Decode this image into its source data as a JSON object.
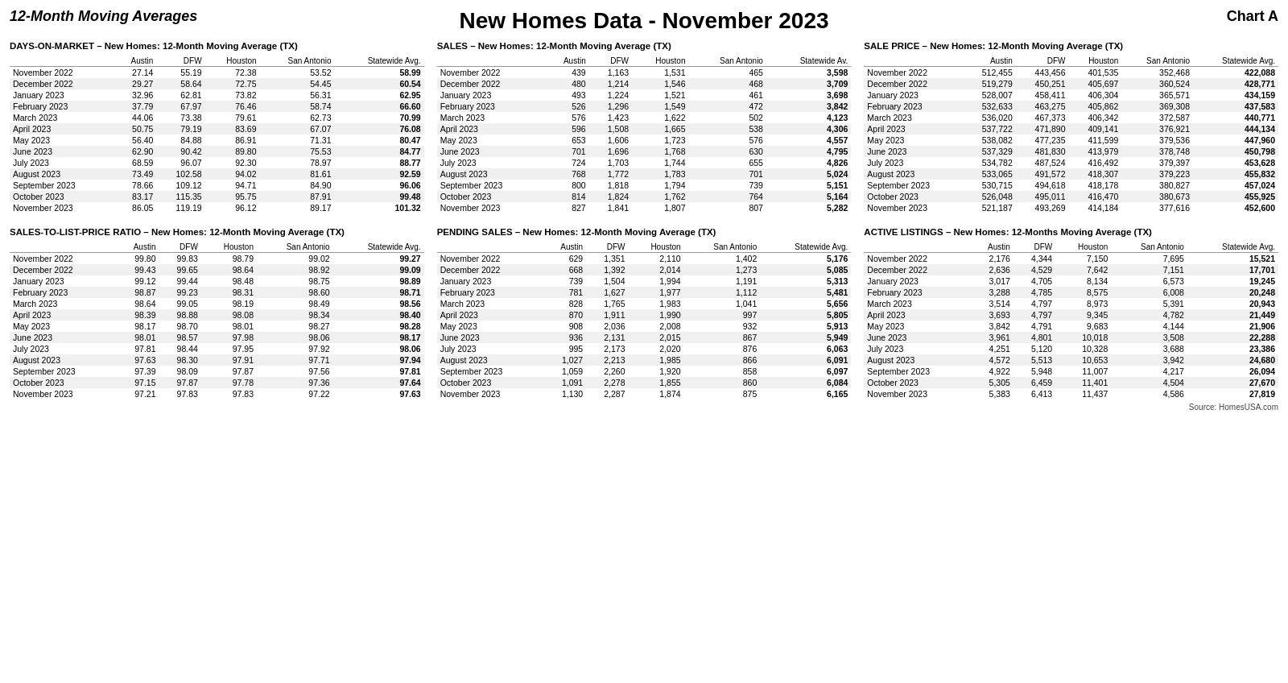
{
  "header": {
    "left": "12-Month Moving Averages",
    "center": "New Homes Data - November 2023",
    "right": "Chart A"
  },
  "sections": {
    "days_on_market": {
      "title": "DAYS-ON-MARKET – New Homes:  12-Month Moving Average (TX)",
      "columns": [
        "",
        "Austin",
        "DFW",
        "Houston",
        "San Antonio",
        "Statewide Avg."
      ],
      "rows": [
        [
          "November 2022",
          "27.14",
          "55.19",
          "72.38",
          "53.52",
          "58.99"
        ],
        [
          "December 2022",
          "29.27",
          "58.64",
          "72.75",
          "54.45",
          "60.54"
        ],
        [
          "January 2023",
          "32.96",
          "62.81",
          "73.82",
          "56.31",
          "62.95"
        ],
        [
          "February 2023",
          "37.79",
          "67.97",
          "76.46",
          "58.74",
          "66.60"
        ],
        [
          "March 2023",
          "44.06",
          "73.38",
          "79.61",
          "62.73",
          "70.99"
        ],
        [
          "April 2023",
          "50.75",
          "79.19",
          "83.69",
          "67.07",
          "76.08"
        ],
        [
          "May 2023",
          "56.40",
          "84.88",
          "86.91",
          "71.31",
          "80.47"
        ],
        [
          "June 2023",
          "62.90",
          "90.42",
          "89.80",
          "75.53",
          "84.77"
        ],
        [
          "July 2023",
          "68.59",
          "96.07",
          "92.30",
          "78.97",
          "88.77"
        ],
        [
          "August 2023",
          "73.49",
          "102.58",
          "94.02",
          "81.61",
          "92.59"
        ],
        [
          "September 2023",
          "78.66",
          "109.12",
          "94.71",
          "84.90",
          "96.06"
        ],
        [
          "October 2023",
          "83.17",
          "115.35",
          "95.75",
          "87.91",
          "99.48"
        ],
        [
          "November 2023",
          "86.05",
          "119.19",
          "96.12",
          "89.17",
          "101.32"
        ]
      ]
    },
    "sales": {
      "title": "SALES – New Homes:  12-Month Moving Average (TX)",
      "columns": [
        "",
        "Austin",
        "DFW",
        "Houston",
        "San Antonio",
        "Statewide Av."
      ],
      "rows": [
        [
          "November 2022",
          "439",
          "1,163",
          "1,531",
          "465",
          "3,598"
        ],
        [
          "December 2022",
          "480",
          "1,214",
          "1,546",
          "468",
          "3,709"
        ],
        [
          "January 2023",
          "493",
          "1,224",
          "1,521",
          "461",
          "3,698"
        ],
        [
          "February 2023",
          "526",
          "1,296",
          "1,549",
          "472",
          "3,842"
        ],
        [
          "March 2023",
          "576",
          "1,423",
          "1,622",
          "502",
          "4,123"
        ],
        [
          "April 2023",
          "596",
          "1,508",
          "1,665",
          "538",
          "4,306"
        ],
        [
          "May 2023",
          "653",
          "1,606",
          "1,723",
          "576",
          "4,557"
        ],
        [
          "June 2023",
          "701",
          "1,696",
          "1,768",
          "630",
          "4,795"
        ],
        [
          "July 2023",
          "724",
          "1,703",
          "1,744",
          "655",
          "4,826"
        ],
        [
          "August 2023",
          "768",
          "1,772",
          "1,783",
          "701",
          "5,024"
        ],
        [
          "September 2023",
          "800",
          "1,818",
          "1,794",
          "739",
          "5,151"
        ],
        [
          "October 2023",
          "814",
          "1,824",
          "1,762",
          "764",
          "5,164"
        ],
        [
          "November 2023",
          "827",
          "1,841",
          "1,807",
          "807",
          "5,282"
        ]
      ]
    },
    "sale_price": {
      "title": "SALE PRICE – New Homes:  12-Month Moving Average (TX)",
      "columns": [
        "",
        "Austin",
        "DFW",
        "Houston",
        "San Antonio",
        "Statewide Avg."
      ],
      "rows": [
        [
          "November 2022",
          "512,455",
          "443,456",
          "401,535",
          "352,468",
          "422,088"
        ],
        [
          "December 2022",
          "519,279",
          "450,251",
          "405,697",
          "360,524",
          "428,771"
        ],
        [
          "January 2023",
          "528,007",
          "458,411",
          "406,304",
          "365,571",
          "434,159"
        ],
        [
          "February 2023",
          "532,633",
          "463,275",
          "405,862",
          "369,308",
          "437,583"
        ],
        [
          "March 2023",
          "536,020",
          "467,373",
          "406,342",
          "372,587",
          "440,771"
        ],
        [
          "April 2023",
          "537,722",
          "471,890",
          "409,141",
          "376,921",
          "444,134"
        ],
        [
          "May 2023",
          "538,082",
          "477,235",
          "411,599",
          "379,536",
          "447,960"
        ],
        [
          "June 2023",
          "537,329",
          "481,830",
          "413,979",
          "378,748",
          "450,798"
        ],
        [
          "July 2023",
          "534,782",
          "487,524",
          "416,492",
          "379,397",
          "453,628"
        ],
        [
          "August 2023",
          "533,065",
          "491,572",
          "418,307",
          "379,223",
          "455,832"
        ],
        [
          "September 2023",
          "530,715",
          "494,618",
          "418,178",
          "380,827",
          "457,024"
        ],
        [
          "October 2023",
          "526,048",
          "495,011",
          "416,470",
          "380,673",
          "455,925"
        ],
        [
          "November 2023",
          "521,187",
          "493,269",
          "414,184",
          "377,616",
          "452,600"
        ]
      ]
    },
    "sales_to_list": {
      "title": "SALES-TO-LIST-PRICE RATIO – New Homes:  12-Month Moving Average (TX)",
      "columns": [
        "",
        "Austin",
        "DFW",
        "Houston",
        "San Antonio",
        "Statewide Avg."
      ],
      "rows": [
        [
          "November 2022",
          "99.80",
          "99.83",
          "98.79",
          "99.02",
          "99.27"
        ],
        [
          "December 2022",
          "99.43",
          "99.65",
          "98.64",
          "98.92",
          "99.09"
        ],
        [
          "January 2023",
          "99.12",
          "99.44",
          "98.48",
          "98.75",
          "98.89"
        ],
        [
          "February 2023",
          "98.87",
          "99.23",
          "98.31",
          "98.60",
          "98.71"
        ],
        [
          "March 2023",
          "98.64",
          "99.05",
          "98.19",
          "98.49",
          "98.56"
        ],
        [
          "April 2023",
          "98.39",
          "98.88",
          "98.08",
          "98.34",
          "98.40"
        ],
        [
          "May 2023",
          "98.17",
          "98.70",
          "98.01",
          "98.27",
          "98.28"
        ],
        [
          "June 2023",
          "98.01",
          "98.57",
          "97.98",
          "98.06",
          "98.17"
        ],
        [
          "July 2023",
          "97.81",
          "98.44",
          "97.95",
          "97.92",
          "98.06"
        ],
        [
          "August 2023",
          "97.63",
          "98.30",
          "97.91",
          "97.71",
          "97.94"
        ],
        [
          "September 2023",
          "97.39",
          "98.09",
          "97.87",
          "97.56",
          "97.81"
        ],
        [
          "October 2023",
          "97.15",
          "97.87",
          "97.78",
          "97.36",
          "97.64"
        ],
        [
          "November 2023",
          "97.21",
          "97.83",
          "97.83",
          "97.22",
          "97.63"
        ]
      ]
    },
    "pending_sales": {
      "title": "PENDING SALES – New Homes:  12-Month Moving Average (TX)",
      "columns": [
        "",
        "Austin",
        "DFW",
        "Houston",
        "San Antonio",
        "Statewide Avg."
      ],
      "rows": [
        [
          "November 2022",
          "629",
          "1,351",
          "2,110",
          "1,402",
          "5,176"
        ],
        [
          "December 2022",
          "668",
          "1,392",
          "2,014",
          "1,273",
          "5,085"
        ],
        [
          "January 2023",
          "739",
          "1,504",
          "1,994",
          "1,191",
          "5,313"
        ],
        [
          "February 2023",
          "781",
          "1,627",
          "1,977",
          "1,112",
          "5,481"
        ],
        [
          "March 2023",
          "828",
          "1,765",
          "1,983",
          "1,041",
          "5,656"
        ],
        [
          "April 2023",
          "870",
          "1,911",
          "1,990",
          "997",
          "5,805"
        ],
        [
          "May 2023",
          "908",
          "2,036",
          "2,008",
          "932",
          "5,913"
        ],
        [
          "June 2023",
          "936",
          "2,131",
          "2,015",
          "867",
          "5,949"
        ],
        [
          "July 2023",
          "995",
          "2,173",
          "2,020",
          "876",
          "6,063"
        ],
        [
          "August 2023",
          "1,027",
          "2,213",
          "1,985",
          "866",
          "6,091"
        ],
        [
          "September 2023",
          "1,059",
          "2,260",
          "1,920",
          "858",
          "6,097"
        ],
        [
          "October 2023",
          "1,091",
          "2,278",
          "1,855",
          "860",
          "6,084"
        ],
        [
          "November 2023",
          "1,130",
          "2,287",
          "1,874",
          "875",
          "6,165"
        ]
      ]
    },
    "active_listings": {
      "title": "ACTIVE LISTINGS – New Homes:  12-Months  Moving Average (TX)",
      "columns": [
        "",
        "Austin",
        "DFW",
        "Houston",
        "San Antonio",
        "Statewide Avg."
      ],
      "rows": [
        [
          "November 2022",
          "2,176",
          "4,344",
          "7,150",
          "7,695",
          "15,521"
        ],
        [
          "December 2022",
          "2,636",
          "4,529",
          "7,642",
          "7,151",
          "17,701"
        ],
        [
          "January 2023",
          "3,017",
          "4,705",
          "8,134",
          "6,573",
          "19,245"
        ],
        [
          "February 2023",
          "3,288",
          "4,785",
          "8,575",
          "6,008",
          "20,248"
        ],
        [
          "March 2023",
          "3,514",
          "4,797",
          "8,973",
          "5,391",
          "20,943"
        ],
        [
          "April 2023",
          "3,693",
          "4,797",
          "9,345",
          "4,782",
          "21,449"
        ],
        [
          "May 2023",
          "3,842",
          "4,791",
          "9,683",
          "4,144",
          "21,906"
        ],
        [
          "June 2023",
          "3,961",
          "4,801",
          "10,018",
          "3,508",
          "22,288"
        ],
        [
          "July 2023",
          "4,251",
          "5,120",
          "10,328",
          "3,688",
          "23,386"
        ],
        [
          "August 2023",
          "4,572",
          "5,513",
          "10,653",
          "3,942",
          "24,680"
        ],
        [
          "September 2023",
          "4,922",
          "5,948",
          "11,007",
          "4,217",
          "26,094"
        ],
        [
          "October 2023",
          "5,305",
          "6,459",
          "11,401",
          "4,504",
          "27,670"
        ],
        [
          "November 2023",
          "5,383",
          "6,413",
          "11,437",
          "4,586",
          "27,819"
        ]
      ]
    }
  },
  "footer": "Source: HomesUSA.com"
}
